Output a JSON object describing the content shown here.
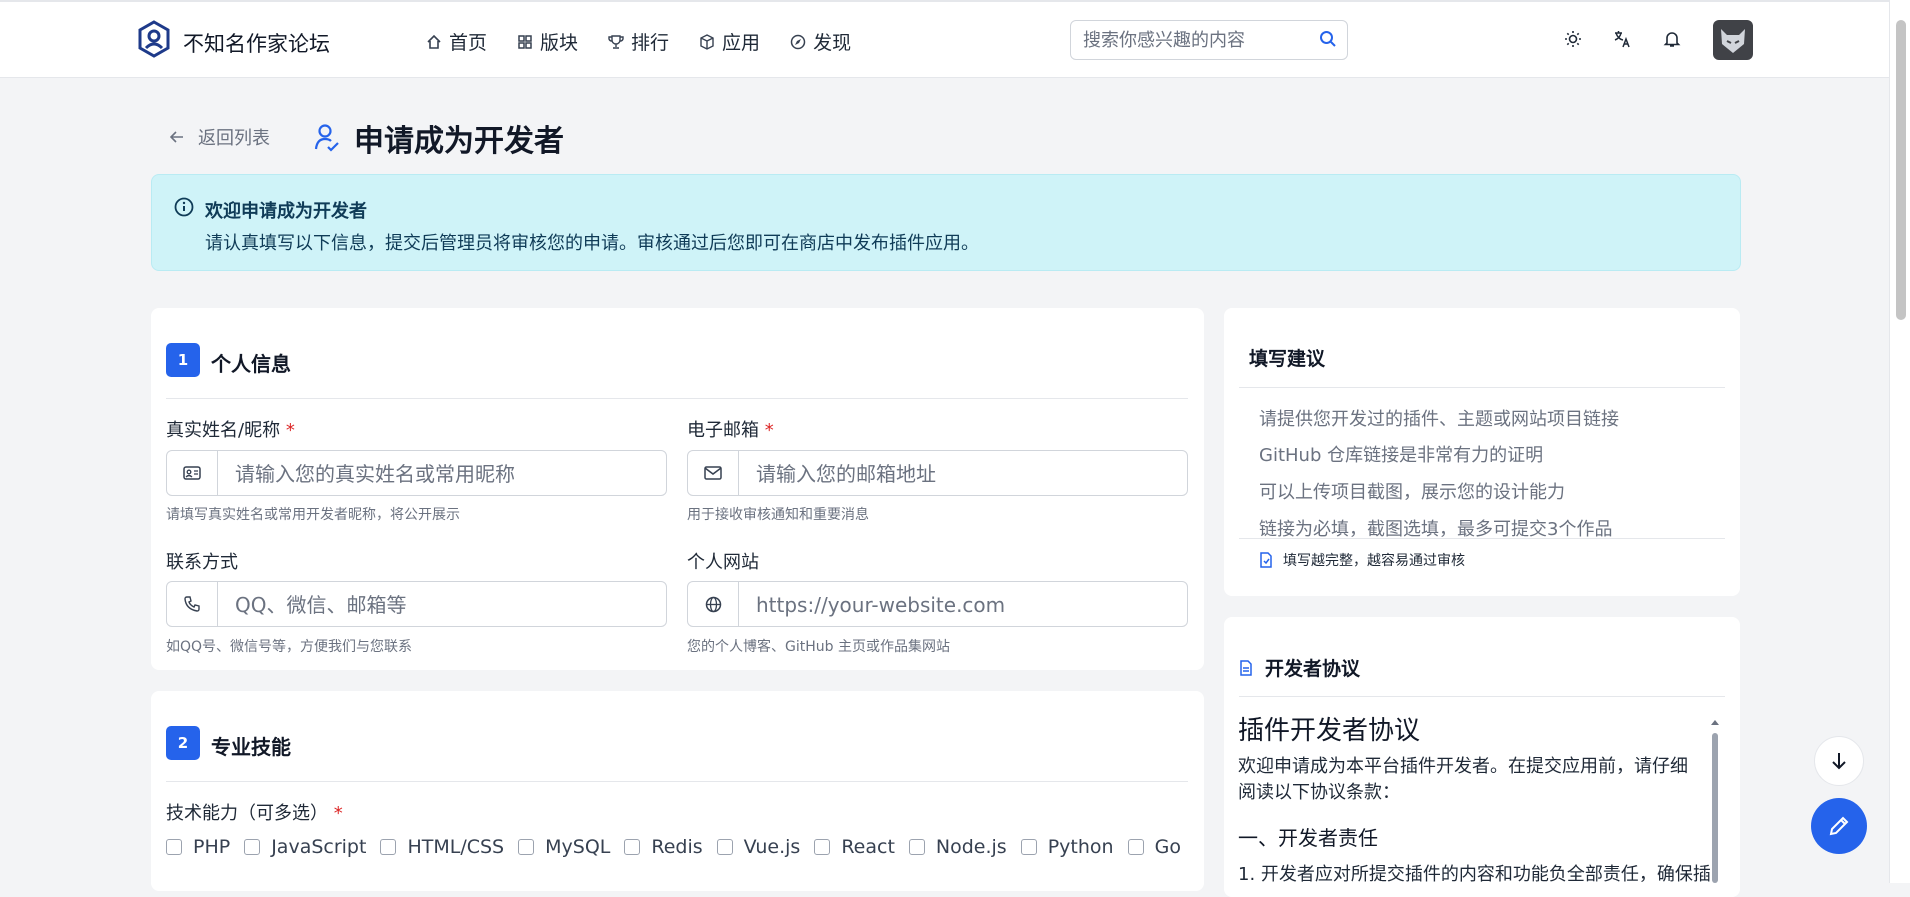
{
  "header": {
    "site_title": "不知名作家论坛",
    "nav": [
      {
        "label": "首页",
        "icon": "home-icon"
      },
      {
        "label": "版块",
        "icon": "grid-icon"
      },
      {
        "label": "排行",
        "icon": "trophy-icon"
      },
      {
        "label": "应用",
        "icon": "cube-icon"
      },
      {
        "label": "发现",
        "icon": "compass-icon"
      }
    ],
    "search_placeholder": "搜索你感兴趣的内容"
  },
  "page": {
    "back_label": "返回列表",
    "title": "申请成为开发者"
  },
  "banner": {
    "title": "欢迎申请成为开发者",
    "text": "请认真填写以下信息，提交后管理员将审核您的申请。审核通过后您即可在商店中发布插件应用。"
  },
  "personal": {
    "number": "1",
    "title": "个人信息",
    "name": {
      "label": "真实姓名/昵称",
      "required": "*",
      "placeholder": "请输入您的真实姓名或常用昵称",
      "help": "请填写真实姓名或常用开发者昵称，将公开展示"
    },
    "email": {
      "label": "电子邮箱",
      "required": "*",
      "placeholder": "请输入您的邮箱地址",
      "help": "用于接收审核通知和重要消息"
    },
    "contact": {
      "label": "联系方式",
      "placeholder": "QQ、微信、邮箱等",
      "help": "如QQ号、微信号等，方便我们与您联系"
    },
    "website": {
      "label": "个人网站",
      "placeholder": "https://your-website.com",
      "help": "您的个人博客、GitHub 主页或作品集网站"
    }
  },
  "skills": {
    "number": "2",
    "title": "专业技能",
    "label": "技术能力（可多选）",
    "required": "*",
    "options": [
      "PHP",
      "JavaScript",
      "HTML/CSS",
      "MySQL",
      "Redis",
      "Vue.js",
      "React",
      "Node.js",
      "Python",
      "Go"
    ]
  },
  "tips": {
    "title": "填写建议",
    "items": [
      "请提供您开发过的插件、主题或网站项目链接",
      "GitHub 仓库链接是非常有力的证明",
      "可以上传项目截图，展示您的设计能力",
      "链接为必填，截图选填，最多可提交3个作品"
    ],
    "footer": "填写越完整，越容易通过审核"
  },
  "agreement": {
    "title": "开发者协议",
    "heading": "插件开发者协议",
    "intro": "欢迎申请成为本平台插件开发者。在提交应用前，请仔细阅读以下协议条款：",
    "section1": "一、开发者责任",
    "item1": "1. 开发者应对所提交插件的内容和功能负全部责任，确保插"
  },
  "colors": {
    "primary": "#2563eb",
    "banner_bg": "#cff3f8",
    "banner_text": "#0f3b57",
    "required": "#dc2626"
  }
}
